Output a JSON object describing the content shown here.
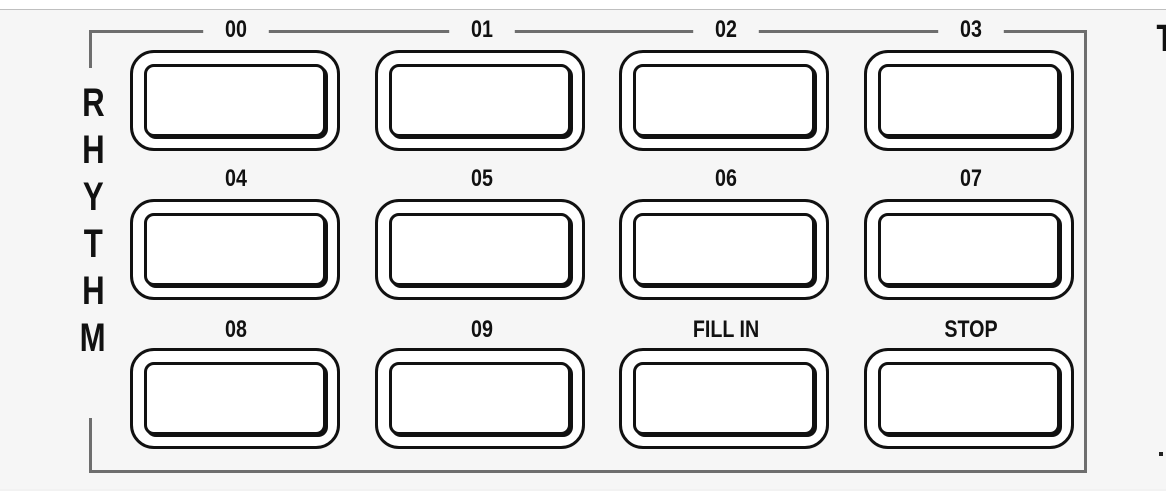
{
  "panel": {
    "title_letters": [
      "R",
      "H",
      "Y",
      "T",
      "H",
      "M"
    ],
    "right_edge_glyph": "T"
  },
  "pads": [
    {
      "label": "00"
    },
    {
      "label": "01"
    },
    {
      "label": "02"
    },
    {
      "label": "03"
    },
    {
      "label": "04"
    },
    {
      "label": "05"
    },
    {
      "label": "06"
    },
    {
      "label": "07"
    },
    {
      "label": "08"
    },
    {
      "label": "09"
    },
    {
      "label": "FILL IN"
    },
    {
      "label": "STOP"
    }
  ]
}
